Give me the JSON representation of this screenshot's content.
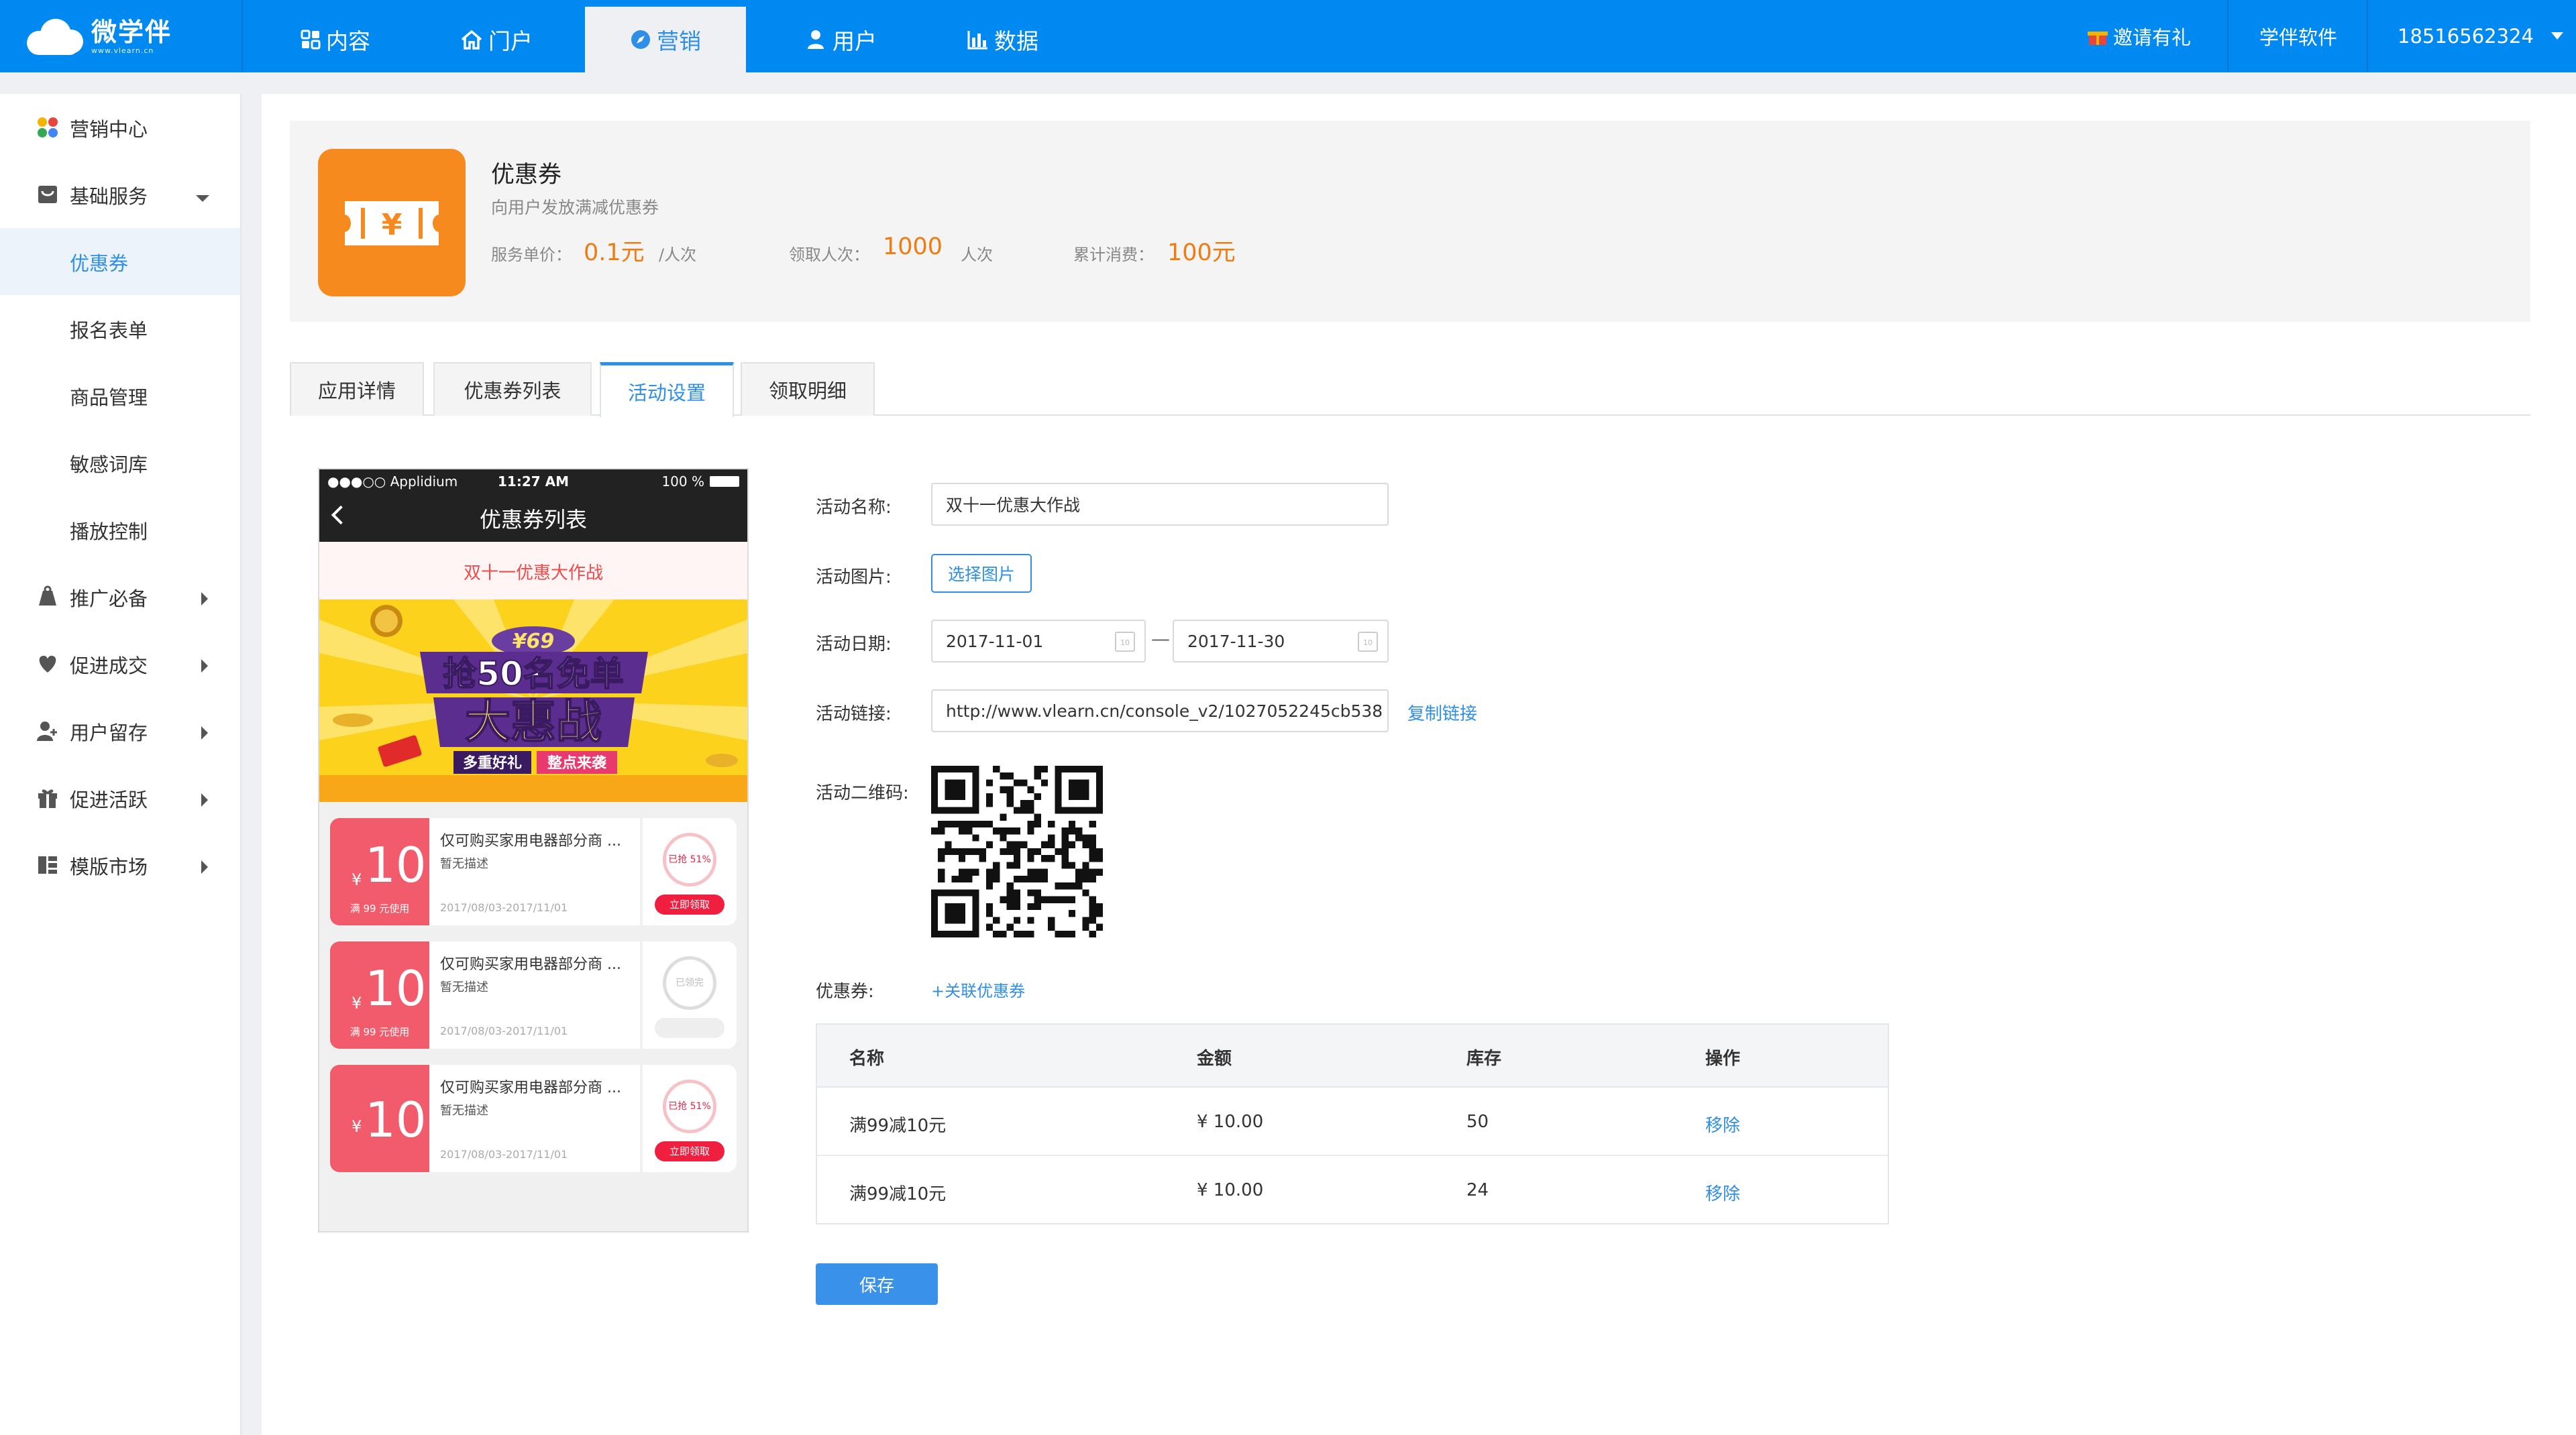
{
  "brand": {
    "name": "微学伴",
    "url": "www.vlearn.cn"
  },
  "top_nav": [
    {
      "label": "内容",
      "icon": "grid-icon"
    },
    {
      "label": "门户",
      "icon": "home-icon"
    },
    {
      "label": "营销",
      "icon": "compass-icon",
      "active": true
    },
    {
      "label": "用户",
      "icon": "user-icon"
    },
    {
      "label": "数据",
      "icon": "bar-chart-icon"
    }
  ],
  "top_right": {
    "invite": "邀请有礼",
    "company": "学伴软件",
    "account": "18516562324"
  },
  "sidebar": [
    {
      "label": "营销中心",
      "icon": "colorful-dots-icon"
    },
    {
      "label": "基础服务",
      "icon": "shop-icon",
      "expanded": true
    },
    {
      "label": "优惠券",
      "sub": true,
      "active": true
    },
    {
      "label": "报名表单",
      "sub": true
    },
    {
      "label": "商品管理",
      "sub": true
    },
    {
      "label": "敏感词库",
      "sub": true
    },
    {
      "label": "播放控制",
      "sub": true
    },
    {
      "label": "推广必备",
      "icon": "bag-icon"
    },
    {
      "label": "促进成交",
      "icon": "heart-icon"
    },
    {
      "label": "用户留存",
      "icon": "user-plus-icon"
    },
    {
      "label": "促进活跃",
      "icon": "gift-icon"
    },
    {
      "label": "模版市场",
      "icon": "template-icon"
    }
  ],
  "app": {
    "title": "优惠券",
    "desc": "向用户发放满减优惠券",
    "price_label": "服务单价：",
    "price_value": "0.1元",
    "price_unit": "/人次",
    "users_label": "领取人次：",
    "users_value": "1000",
    "users_unit": "人次",
    "spend_label": "累计消费：",
    "spend_value": "100元"
  },
  "tabs": [
    "应用详情",
    "优惠券列表",
    "活动设置",
    "领取明细"
  ],
  "active_tab": 2,
  "phone": {
    "status_left": "●●●○○ Applidium",
    "status_time": "11:27 AM",
    "status_battery": "100 %",
    "nav_title": "优惠券列表",
    "activity_name": "双十一优惠大作战",
    "banner": {
      "price": "¥69",
      "line1": "抢50名免单",
      "line2": "大惠战",
      "line3": "多重好礼",
      "line4": "整点来袭"
    },
    "coupons": [
      {
        "yen": "¥",
        "amount": "10",
        "cond": "满 99 元使用",
        "title": "仅可购买家用电器部分商 ...",
        "desc": "暂无描述",
        "date": "2017/08/03-2017/11/01",
        "ring": "已抢 51%",
        "btn": "立即领取",
        "done": false
      },
      {
        "yen": "¥",
        "amount": "10",
        "cond": "满 99 元使用",
        "title": "仅可购买家用电器部分商 ...",
        "desc": "暂无描述",
        "date": "2017/08/03-2017/11/01",
        "ring": "已领完",
        "btn": "立即领取",
        "done": true
      },
      {
        "yen": "¥",
        "amount": "10",
        "cond": "",
        "title": "仅可购买家用电器部分商 ...",
        "desc": "暂无描述",
        "date": "2017/08/03-2017/11/01",
        "ring": "已抢 51%",
        "btn": "立即领取",
        "done": false
      }
    ]
  },
  "form": {
    "name_label": "活动名称:",
    "name_value": "双十一优惠大作战",
    "image_label": "活动图片:",
    "image_btn": "选择图片",
    "date_label": "活动日期:",
    "date_start": "2017-11-01",
    "date_end": "2017-11-30",
    "date_sep": "—",
    "cal_day": "10",
    "link_label": "活动链接:",
    "link_value": "http://www.vlearn.cn/console_v2/1027052245cb538",
    "copy_link": "复制链接",
    "qr_label": "活动二维码:",
    "coupon_label": "优惠券:",
    "add_coupon": "+关联优惠券"
  },
  "table": {
    "headers": [
      "名称",
      "金额",
      "库存",
      "操作"
    ],
    "rows": [
      {
        "name": "满99减10元",
        "amount": "¥ 10.00",
        "stock": "50",
        "op": "移除"
      },
      {
        "name": "满99减10元",
        "amount": "¥ 10.00",
        "stock": "24",
        "op": "移除"
      }
    ]
  },
  "save_label": "保存",
  "colors": {
    "primary": "#0089f0",
    "accent": "#2f8fe6",
    "orange": "#f07b12",
    "coupon_red": "#f25b6c"
  }
}
